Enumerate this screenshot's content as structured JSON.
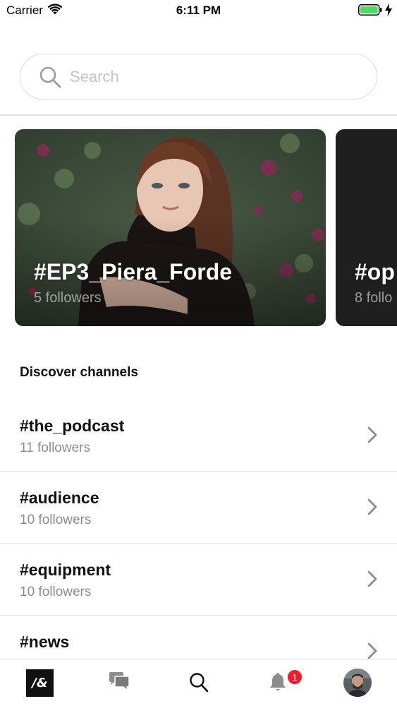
{
  "status_bar": {
    "carrier": "Carrier",
    "time": "6:11 PM",
    "battery_color": "#4cd964"
  },
  "search": {
    "placeholder": "Search",
    "value": ""
  },
  "featured": [
    {
      "title": "#EP3_Piera_Forde",
      "followers": "5 followers"
    },
    {
      "title": "#op",
      "followers": "8 follo"
    }
  ],
  "discover": {
    "title": "Discover channels",
    "channels": [
      {
        "name": "#the_podcast",
        "followers": "11 followers"
      },
      {
        "name": "#audience",
        "followers": "10 followers"
      },
      {
        "name": "#equipment",
        "followers": "10 followers"
      },
      {
        "name": "#news",
        "followers": ""
      }
    ]
  },
  "tab_bar": {
    "logo_text": "/&",
    "notifications_badge": "1",
    "items": [
      "home-logo-icon",
      "chat-icon",
      "search-icon",
      "bell-icon",
      "avatar"
    ],
    "accent_color": "#f41c2a"
  }
}
